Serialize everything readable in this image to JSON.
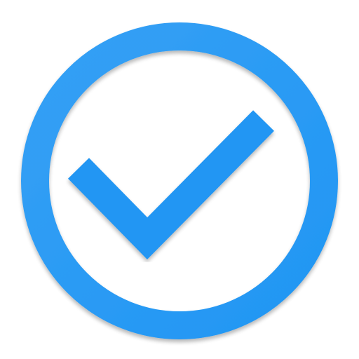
{
  "icon": {
    "name": "check-circle-icon",
    "colors": {
      "primary": "#2196F3",
      "highlight": "#35A0F5",
      "background": "#FFFFFF"
    }
  }
}
